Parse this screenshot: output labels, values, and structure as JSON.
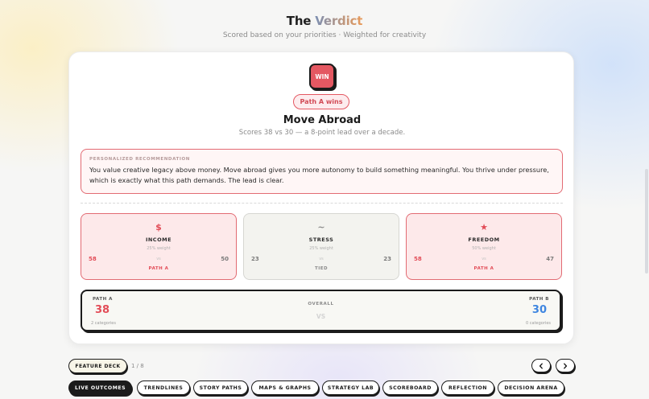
{
  "header": {
    "title_part1": "The ",
    "title_part2": "Verdict",
    "subtitle": "Scored based on your priorities · Weighted for creativity"
  },
  "verdict": {
    "badge": "WIN",
    "pill": "Path A wins",
    "winner": "Move Abroad",
    "summary": "Scores 38 vs 30 — a 8-point lead over a decade."
  },
  "recommendation": {
    "label": "PERSONALIZED RECOMMENDATION",
    "text": "You value creative legacy above money. Move abroad gives you more autonomy to build something meaningful. You thrive under pressure, which is exactly what this path demands. The lead is clear."
  },
  "categories": [
    {
      "icon": "$",
      "icon_name": "dollar-icon",
      "name": "INCOME",
      "weight": "25% weight",
      "vs": "vs",
      "score_a": "58",
      "score_b": "50",
      "result": "PATH A"
    },
    {
      "icon": "~",
      "icon_name": "wave-icon",
      "name": "STRESS",
      "weight": "25% weight",
      "vs": "vs",
      "score_a": "23",
      "score_b": "23",
      "result": "TIED"
    },
    {
      "icon": "★",
      "icon_name": "star-icon",
      "name": "FREEDOM",
      "weight": "50% weight",
      "vs": "vs",
      "score_a": "58",
      "score_b": "47",
      "result": "PATH A"
    }
  ],
  "overall": {
    "path_a_label": "PATH A",
    "path_a_score": "38",
    "path_a_categories": "2 categories",
    "mid_label": "OVERALL",
    "mid_vs": "VS",
    "path_b_label": "PATH B",
    "path_b_score": "30",
    "path_b_categories": "0 categories"
  },
  "deck": {
    "button": "FEATURE DECK",
    "count": "1 / 8",
    "prev_icon": "chevron-left-icon",
    "next_icon": "chevron-right-icon"
  },
  "tabs": [
    {
      "label": "LIVE OUTCOMES",
      "active": true
    },
    {
      "label": "TRENDLINES",
      "active": false
    },
    {
      "label": "STORY PATHS",
      "active": false
    },
    {
      "label": "MAPS & GRAPHS",
      "active": false
    },
    {
      "label": "STRATEGY LAB",
      "active": false
    },
    {
      "label": "SCOREBOARD",
      "active": false
    },
    {
      "label": "REFLECTION",
      "active": false
    },
    {
      "label": "DECISION ARENA",
      "active": false
    }
  ],
  "colors": {
    "path_a": "#e24c57",
    "path_b": "#3f86e0",
    "ink": "#1b1b1b"
  }
}
